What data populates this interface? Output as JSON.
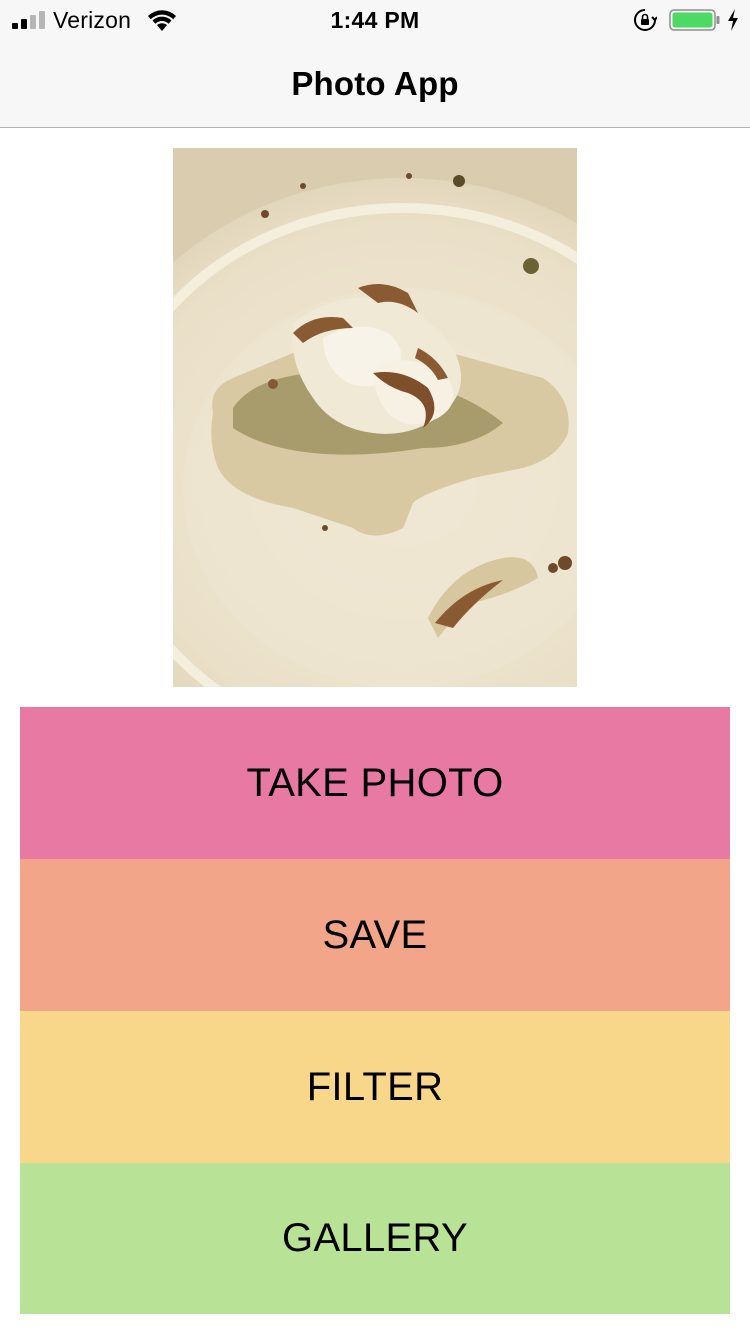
{
  "status_bar": {
    "carrier": "Verizon",
    "time": "1:44 PM",
    "icons": [
      "signal-icon",
      "wifi-icon",
      "orientation-lock-icon",
      "battery-icon",
      "charging-icon"
    ],
    "battery_color": "#4cd964"
  },
  "nav": {
    "title": "Photo App"
  },
  "photo": {
    "subject": "sepia-filtered food on plate"
  },
  "buttons": {
    "take_photo": {
      "label": "TAKE PHOTO",
      "color": "#e879a3"
    },
    "save": {
      "label": "SAVE",
      "color": "#f3a58a"
    },
    "filter": {
      "label": "FILTER",
      "color": "#f8d78a"
    },
    "gallery": {
      "label": "GALLERY",
      "color": "#b8e296"
    }
  }
}
